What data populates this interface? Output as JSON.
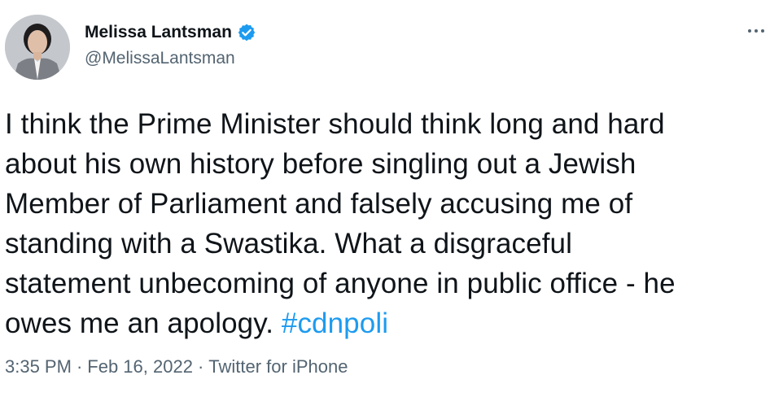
{
  "author": {
    "display_name": "Melissa Lantsman",
    "handle": "@MelissaLantsman",
    "verified_icon": "verified-badge-icon",
    "avatar_icon": "profile-photo"
  },
  "more_icon": "more-options-icon",
  "tweet": {
    "text": "I think the Prime Minister should think long and hard\nabout his own history before singling out a Jewish\nMember of Parliament and falsely accusing me of\nstanding with a Swastika. What a disgraceful\nstatement unbecoming of anyone in public office - he\nowes me an apology. ",
    "hashtag": "#cdnpoli"
  },
  "meta": {
    "time": "3:35 PM",
    "separator": "·",
    "date": "Feb 16, 2022",
    "source": "Twitter for iPhone"
  },
  "colors": {
    "accent": "#1d9bf0",
    "text": "#0f1419",
    "secondary": "#536471"
  }
}
